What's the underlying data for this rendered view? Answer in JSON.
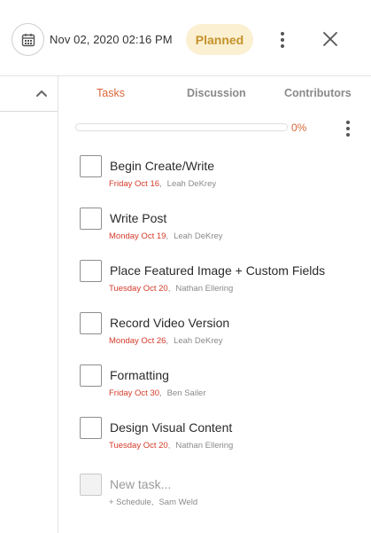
{
  "header": {
    "calendar_icon": "calendar-icon",
    "date": "Nov 02, 2020 02:16 PM",
    "status": "Planned",
    "status_color": "#c4922a",
    "status_bg": "#fbf0d2",
    "more_icon": "more-vertical-icon",
    "close_icon": "close-icon"
  },
  "left_pane": {
    "collapse_icon": "chevron-up-icon"
  },
  "tabs": [
    {
      "label": "Tasks",
      "active": true
    },
    {
      "label": "Discussion",
      "active": false
    },
    {
      "label": "Contributors",
      "active": false
    }
  ],
  "progress": {
    "label": "0%",
    "value": 0,
    "accent": "#d9683b"
  },
  "tasks": [
    {
      "title": "Begin Create/Write",
      "date": "Friday Oct 16",
      "assignee": "Leah DeKrey"
    },
    {
      "title": "Write Post",
      "date": "Monday Oct 19",
      "assignee": "Leah DeKrey"
    },
    {
      "title": "Place Featured Image + Custom Fields",
      "date": "Tuesday Oct 20",
      "assignee": "Nathan Ellering"
    },
    {
      "title": "Record Video Version",
      "date": "Monday Oct 26",
      "assignee": "Leah DeKrey"
    },
    {
      "title": "Formatting",
      "date": "Friday Oct 30",
      "assignee": "Ben Sailer"
    },
    {
      "title": "Design Visual Content",
      "date": "Tuesday Oct 20",
      "assignee": "Nathan Ellering"
    }
  ],
  "new_task": {
    "placeholder": "New task...",
    "schedule": "+ Schedule",
    "assignee": "Sam Weld"
  },
  "separator": ",",
  "date_color": "#d33b2a"
}
